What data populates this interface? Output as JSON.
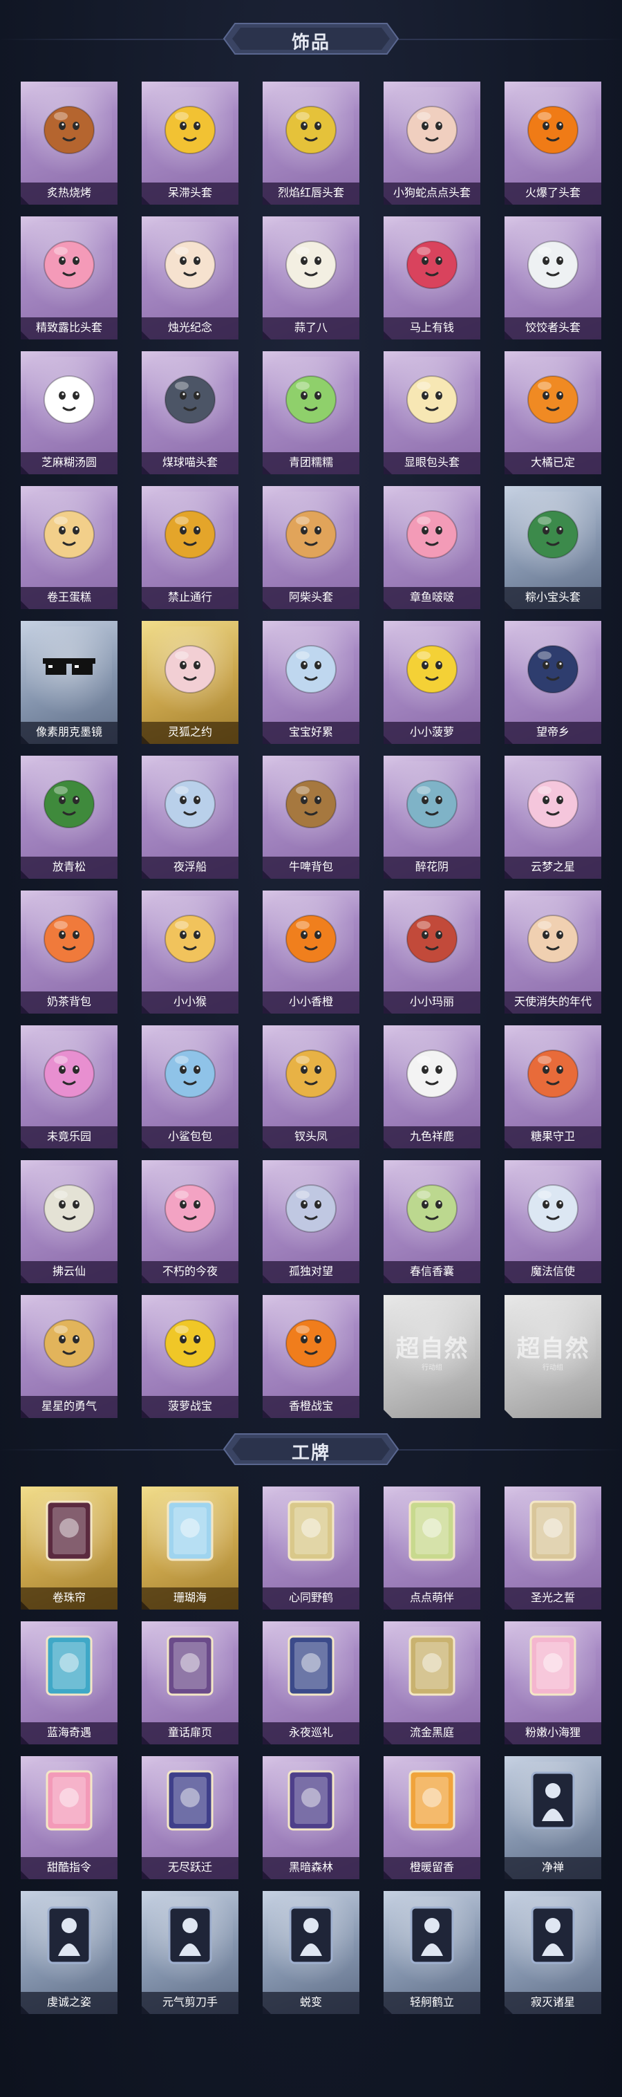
{
  "accessories": {
    "title": "饰品",
    "items": [
      {
        "label": "炙热烧烤",
        "variant": "purple",
        "icon": "barbecue-head-icon",
        "color": "#b5652f"
      },
      {
        "label": "呆滞头套",
        "variant": "purple",
        "icon": "dazed-face-head-icon",
        "color": "#f2c233"
      },
      {
        "label": "烈焰红唇头套",
        "variant": "purple",
        "icon": "red-lips-head-icon",
        "color": "#e5c23a"
      },
      {
        "label": "小狗蛇点点头套",
        "variant": "purple",
        "icon": "snake-head-icon",
        "color": "#f0cfbf"
      },
      {
        "label": "火爆了头套",
        "variant": "purple",
        "icon": "fire-head-icon",
        "color": "#f07b16"
      },
      {
        "label": "精致露比头套",
        "variant": "purple",
        "icon": "pink-pig-head-icon",
        "color": "#f49ab8"
      },
      {
        "label": "烛光纪念",
        "variant": "purple",
        "icon": "candle-head-icon",
        "color": "#f6e2cf"
      },
      {
        "label": "蒜了八",
        "variant": "purple",
        "icon": "garlic-head-icon",
        "color": "#f3efe2"
      },
      {
        "label": "马上有钱",
        "variant": "purple",
        "icon": "horse-head-icon",
        "color": "#d9435d"
      },
      {
        "label": "饺饺者头套",
        "variant": "purple",
        "icon": "dumpling-head-icon",
        "color": "#eef1f3"
      },
      {
        "label": "芝麻糊汤圆",
        "variant": "purple",
        "icon": "tangyuan-head-icon",
        "color": "#ffffff"
      },
      {
        "label": "煤球喵头套",
        "variant": "purple",
        "icon": "cat-head-icon",
        "color": "#4c5566"
      },
      {
        "label": "青团糯糯",
        "variant": "purple",
        "icon": "qingtuan-head-icon",
        "color": "#8fd06b"
      },
      {
        "label": "显眼包头套",
        "variant": "purple",
        "icon": "bun-head-icon",
        "color": "#f7e7b4"
      },
      {
        "label": "大橘已定",
        "variant": "purple",
        "icon": "orange-head-icon",
        "color": "#f08a23"
      },
      {
        "label": "卷王蛋糕",
        "variant": "purple",
        "icon": "cake-roll-head-icon",
        "color": "#f2cf8a"
      },
      {
        "label": "禁止通行",
        "variant": "purple",
        "icon": "no-entry-head-icon",
        "color": "#e4a52a"
      },
      {
        "label": "阿柴头套",
        "variant": "purple",
        "icon": "shiba-head-icon",
        "color": "#e1a45a"
      },
      {
        "label": "章鱼啵啵",
        "variant": "purple",
        "icon": "octopus-head-icon",
        "color": "#f39bb7"
      },
      {
        "label": "粽小宝头套",
        "variant": "blue",
        "icon": "zongzi-head-icon",
        "color": "#3c8a4b"
      },
      {
        "label": "像素朋克墨镜",
        "variant": "blue",
        "icon": "pixel-sunglasses-icon",
        "color": "#1b1b1b"
      },
      {
        "label": "灵狐之约",
        "variant": "gold",
        "icon": "fox-ears-icon",
        "color": "#f2cfd4"
      },
      {
        "label": "宝宝好累",
        "variant": "purple",
        "icon": "tired-baby-icon",
        "color": "#bfd7ef"
      },
      {
        "label": "小小菠萝",
        "variant": "purple",
        "icon": "pineapple-icon",
        "color": "#f4d136"
      },
      {
        "label": "望帝乡",
        "variant": "purple",
        "icon": "lady-figure-icon",
        "color": "#2e3d6e"
      },
      {
        "label": "放青松",
        "variant": "purple",
        "icon": "potted-pine-icon",
        "color": "#3f8a3c"
      },
      {
        "label": "夜浮船",
        "variant": "purple",
        "icon": "night-boat-icon",
        "color": "#b9d0ea"
      },
      {
        "label": "牛啤背包",
        "variant": "purple",
        "icon": "beer-backpack-icon",
        "color": "#a6783f"
      },
      {
        "label": "醉花阴",
        "variant": "purple",
        "icon": "flower-ornament-icon",
        "color": "#7fb3c7"
      },
      {
        "label": "云梦之星",
        "variant": "purple",
        "icon": "unicorn-cloud-icon",
        "color": "#f5c6dc"
      },
      {
        "label": "奶茶背包",
        "variant": "purple",
        "icon": "milk-tea-backpack-icon",
        "color": "#f07a3b"
      },
      {
        "label": "小小猴",
        "variant": "purple",
        "icon": "monkey-icon",
        "color": "#f1c35c"
      },
      {
        "label": "小小香橙",
        "variant": "purple",
        "icon": "orange-warrior-icon",
        "color": "#f07f1d"
      },
      {
        "label": "小小玛丽",
        "variant": "purple",
        "icon": "mary-doll-icon",
        "color": "#c24a3a"
      },
      {
        "label": "天使消失的年代",
        "variant": "purple",
        "icon": "angel-doll-icon",
        "color": "#f0d0b1"
      },
      {
        "label": "未竟乐园",
        "variant": "purple",
        "icon": "pink-girl-icon",
        "color": "#e88fd0"
      },
      {
        "label": "小鲨包包",
        "variant": "purple",
        "icon": "shark-bag-icon",
        "color": "#8fc3e8"
      },
      {
        "label": "钗头凤",
        "variant": "purple",
        "icon": "phoenix-crown-icon",
        "color": "#e8b245"
      },
      {
        "label": "九色祥鹿",
        "variant": "purple",
        "icon": "deer-icon",
        "color": "#f3f3f3"
      },
      {
        "label": "糖果守卫",
        "variant": "purple",
        "icon": "candy-guard-icon",
        "color": "#e86b3a"
      },
      {
        "label": "拂云仙",
        "variant": "purple",
        "icon": "fairy-charm-icon",
        "color": "#e4e2d5"
      },
      {
        "label": "不朽的今夜",
        "variant": "purple",
        "icon": "pink-charm-icon",
        "color": "#f3a3c3"
      },
      {
        "label": "孤独对望",
        "variant": "purple",
        "icon": "lonely-charm-icon",
        "color": "#c0c8e2"
      },
      {
        "label": "春信香囊",
        "variant": "purple",
        "icon": "sachet-icon",
        "color": "#bcd88f"
      },
      {
        "label": "魔法信使",
        "variant": "purple",
        "icon": "elephant-mouse-icon",
        "color": "#dce7f3"
      },
      {
        "label": "星星的勇气",
        "variant": "purple",
        "icon": "star-planet-icon",
        "color": "#e2b45b"
      },
      {
        "label": "菠萝战宝",
        "variant": "purple",
        "icon": "pineapple-robot-icon",
        "color": "#f0c727"
      },
      {
        "label": "香橙战宝",
        "variant": "purple",
        "icon": "orange-robot-icon",
        "color": "#f07d1c"
      },
      {
        "label": "",
        "variant": "gray",
        "icon": "placeholder-logo-icon",
        "color": "#bdbdbd",
        "placeholder_text": "超自然",
        "placeholder_sub": "行动组"
      },
      {
        "label": "",
        "variant": "gray",
        "icon": "placeholder-logo-icon",
        "color": "#bdbdbd",
        "placeholder_text": "超自然",
        "placeholder_sub": "行动组"
      }
    ]
  },
  "badges": {
    "title": "工牌",
    "items": [
      {
        "label": "卷珠帘",
        "variant": "gold",
        "icon": "curtain-card-icon",
        "color": "#5b2a3f"
      },
      {
        "label": "珊瑚海",
        "variant": "gold",
        "icon": "coral-sea-card-icon",
        "color": "#9fd4ef"
      },
      {
        "label": "心同野鹤",
        "variant": "purple",
        "icon": "crane-card-icon",
        "color": "#d9c88a"
      },
      {
        "label": "点点萌伴",
        "variant": "purple",
        "icon": "field-card-icon",
        "color": "#c8d98e"
      },
      {
        "label": "圣光之誓",
        "variant": "purple",
        "icon": "holy-card-icon",
        "color": "#d9c69a"
      },
      {
        "label": "蓝海奇遇",
        "variant": "purple",
        "icon": "blue-sea-card-icon",
        "color": "#3fa8c7"
      },
      {
        "label": "童话扉页",
        "variant": "purple",
        "icon": "fairy-tale-card-icon",
        "color": "#6b4b8a"
      },
      {
        "label": "永夜巡礼",
        "variant": "purple",
        "icon": "night-card-icon",
        "color": "#3b4a8a"
      },
      {
        "label": "流金黑庭",
        "variant": "purple",
        "icon": "gold-court-card-icon",
        "color": "#c9b26f"
      },
      {
        "label": "粉嫩小海狸",
        "variant": "purple",
        "icon": "pink-beaver-card-icon",
        "color": "#f4b6cf"
      },
      {
        "label": "甜酷指令",
        "variant": "purple",
        "icon": "sweet-cool-card-icon",
        "color": "#f39ab8"
      },
      {
        "label": "无尽跃迁",
        "variant": "purple",
        "icon": "warp-card-icon",
        "color": "#3f3f8a"
      },
      {
        "label": "黑暗森林",
        "variant": "purple",
        "icon": "dark-forest-card-icon",
        "color": "#4e3f8a"
      },
      {
        "label": "橙暖留香",
        "variant": "purple",
        "icon": "orange-card-icon",
        "color": "#f0a33b"
      },
      {
        "label": "净禅",
        "variant": "blue",
        "icon": "silhouette-card-icon",
        "color": "#2b3248"
      },
      {
        "label": "虔诚之姿",
        "variant": "blue",
        "icon": "silhouette-card-icon",
        "color": "#2b3248"
      },
      {
        "label": "元气剪刀手",
        "variant": "blue",
        "icon": "silhouette-card-icon",
        "color": "#2b3248"
      },
      {
        "label": "蜕变",
        "variant": "blue",
        "icon": "silhouette-card-icon",
        "color": "#2b3248"
      },
      {
        "label": "轻舸鹤立",
        "variant": "blue",
        "icon": "silhouette-card-icon",
        "color": "#2b3248"
      },
      {
        "label": "寂灭诸星",
        "variant": "blue",
        "icon": "silhouette-card-icon",
        "color": "#2b3248"
      }
    ]
  }
}
